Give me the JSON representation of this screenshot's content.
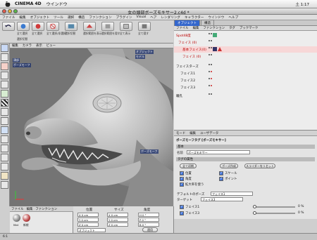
{
  "menubar": {
    "app": "CINEMA 4D",
    "window": "ウインドウ",
    "clock": "土 1:17"
  },
  "window": {
    "title": "女の頭部ボーズモキサー2.c4d *"
  },
  "appmenu": [
    "ファイル",
    "編集",
    "オブジェクト",
    "ツール",
    "選択",
    "構造",
    "ファンクション",
    "プラグイン",
    "Visual",
    "ヘア",
    "レンダリング",
    "キャラクター",
    "ウインドウ",
    "ヘルプ"
  ],
  "toolbar": {
    "labels": [
      "全て選択",
      "全て選択",
      "全て選択/非選択",
      "選択切替",
      "選択範囲を表示",
      "選択範囲を隠す",
      "全て表示",
      "全て隠す",
      "選択切替"
    ]
  },
  "viewport": {
    "menu": [
      "編集",
      "カメラ",
      "表示",
      "ビュー"
    ],
    "labels": [
      "頭部",
      "ポーズモーフ",
      "オブジェクト",
      "モデル",
      "ポーズモーフ"
    ]
  },
  "rightpanel": {
    "tabs": [
      "オブジェクト",
      "構造"
    ],
    "menu": [
      "ファイル",
      "編集",
      "ファンクション",
      "タグ",
      "ブックマーク"
    ],
    "objects": [
      {
        "name": "Spot48度"
      },
      {
        "name": "フェイス (0)"
      },
      {
        "name": "基本フェイス(0)"
      },
      {
        "name": "フェイス (0)"
      },
      {
        "name": "フェイスターズ"
      },
      {
        "name": "フェイス1"
      },
      {
        "name": "フェイス2"
      },
      {
        "name": "フェイス3"
      },
      {
        "name": "瞳孔"
      }
    ]
  },
  "attributes": {
    "menu": [
      "モード",
      "編集",
      "ユーザデータ"
    ],
    "title": "ポーズモーフタグ [ポーズモキサー]",
    "section": "基本",
    "name_label": "名前",
    "name_value": "ポーズモキサー",
    "tag_props": "タグの属性",
    "buttons": [
      "全て初期",
      "ポーズ作成",
      "スライダーをリセット"
    ],
    "checks": [
      "位置",
      "角度",
      "拡大率を使う"
    ],
    "checks2": [
      "スケール",
      "ポイント"
    ],
    "default_pose_label": "デフォルトのポーズ",
    "default_pose_value": "フェイス1",
    "target_label": "ターゲット",
    "target_value": "フェイス3",
    "sliders": [
      {
        "label": "フェイス1",
        "value": "0 %"
      },
      {
        "label": "フェイス3",
        "value": "0 %"
      }
    ]
  },
  "materials": {
    "menu": [
      "ファイル",
      "編集",
      "ファンクション"
    ],
    "items": [
      "Mat",
      "新規"
    ]
  },
  "coords": {
    "headers": [
      "位置",
      "サイズ",
      "角度"
    ],
    "rows": [
      [
        "X 0 cm",
        "X 0 cm",
        "H 0 °"
      ],
      [
        "Y 0 cm",
        "Y 0 cm",
        "P 0 °"
      ],
      [
        "Z 0 cm",
        "Z 0 cm",
        "B 0 °"
      ]
    ],
    "mode": "オブジェクト",
    "apply": "適用"
  },
  "status": "6:1"
}
